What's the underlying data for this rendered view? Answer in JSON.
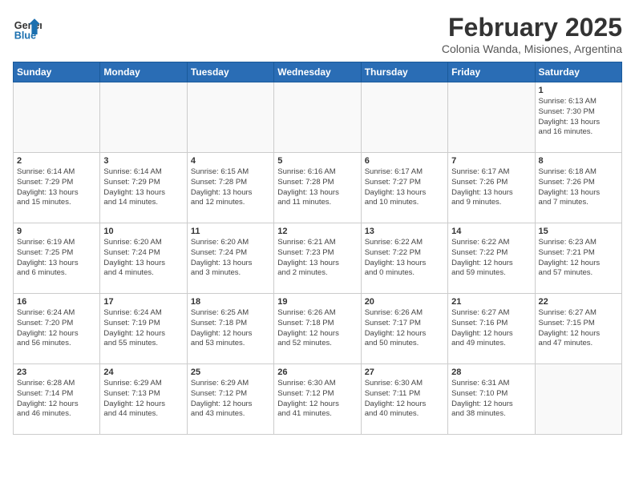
{
  "header": {
    "logo_line1": "General",
    "logo_line2": "Blue",
    "month": "February 2025",
    "location": "Colonia Wanda, Misiones, Argentina"
  },
  "weekdays": [
    "Sunday",
    "Monday",
    "Tuesday",
    "Wednesday",
    "Thursday",
    "Friday",
    "Saturday"
  ],
  "weeks": [
    [
      {
        "day": "",
        "info": ""
      },
      {
        "day": "",
        "info": ""
      },
      {
        "day": "",
        "info": ""
      },
      {
        "day": "",
        "info": ""
      },
      {
        "day": "",
        "info": ""
      },
      {
        "day": "",
        "info": ""
      },
      {
        "day": "1",
        "info": "Sunrise: 6:13 AM\nSunset: 7:30 PM\nDaylight: 13 hours\nand 16 minutes."
      }
    ],
    [
      {
        "day": "2",
        "info": "Sunrise: 6:14 AM\nSunset: 7:29 PM\nDaylight: 13 hours\nand 15 minutes."
      },
      {
        "day": "3",
        "info": "Sunrise: 6:14 AM\nSunset: 7:29 PM\nDaylight: 13 hours\nand 14 minutes."
      },
      {
        "day": "4",
        "info": "Sunrise: 6:15 AM\nSunset: 7:28 PM\nDaylight: 13 hours\nand 12 minutes."
      },
      {
        "day": "5",
        "info": "Sunrise: 6:16 AM\nSunset: 7:28 PM\nDaylight: 13 hours\nand 11 minutes."
      },
      {
        "day": "6",
        "info": "Sunrise: 6:17 AM\nSunset: 7:27 PM\nDaylight: 13 hours\nand 10 minutes."
      },
      {
        "day": "7",
        "info": "Sunrise: 6:17 AM\nSunset: 7:26 PM\nDaylight: 13 hours\nand 9 minutes."
      },
      {
        "day": "8",
        "info": "Sunrise: 6:18 AM\nSunset: 7:26 PM\nDaylight: 13 hours\nand 7 minutes."
      }
    ],
    [
      {
        "day": "9",
        "info": "Sunrise: 6:19 AM\nSunset: 7:25 PM\nDaylight: 13 hours\nand 6 minutes."
      },
      {
        "day": "10",
        "info": "Sunrise: 6:20 AM\nSunset: 7:24 PM\nDaylight: 13 hours\nand 4 minutes."
      },
      {
        "day": "11",
        "info": "Sunrise: 6:20 AM\nSunset: 7:24 PM\nDaylight: 13 hours\nand 3 minutes."
      },
      {
        "day": "12",
        "info": "Sunrise: 6:21 AM\nSunset: 7:23 PM\nDaylight: 13 hours\nand 2 minutes."
      },
      {
        "day": "13",
        "info": "Sunrise: 6:22 AM\nSunset: 7:22 PM\nDaylight: 13 hours\nand 0 minutes."
      },
      {
        "day": "14",
        "info": "Sunrise: 6:22 AM\nSunset: 7:22 PM\nDaylight: 12 hours\nand 59 minutes."
      },
      {
        "day": "15",
        "info": "Sunrise: 6:23 AM\nSunset: 7:21 PM\nDaylight: 12 hours\nand 57 minutes."
      }
    ],
    [
      {
        "day": "16",
        "info": "Sunrise: 6:24 AM\nSunset: 7:20 PM\nDaylight: 12 hours\nand 56 minutes."
      },
      {
        "day": "17",
        "info": "Sunrise: 6:24 AM\nSunset: 7:19 PM\nDaylight: 12 hours\nand 55 minutes."
      },
      {
        "day": "18",
        "info": "Sunrise: 6:25 AM\nSunset: 7:18 PM\nDaylight: 12 hours\nand 53 minutes."
      },
      {
        "day": "19",
        "info": "Sunrise: 6:26 AM\nSunset: 7:18 PM\nDaylight: 12 hours\nand 52 minutes."
      },
      {
        "day": "20",
        "info": "Sunrise: 6:26 AM\nSunset: 7:17 PM\nDaylight: 12 hours\nand 50 minutes."
      },
      {
        "day": "21",
        "info": "Sunrise: 6:27 AM\nSunset: 7:16 PM\nDaylight: 12 hours\nand 49 minutes."
      },
      {
        "day": "22",
        "info": "Sunrise: 6:27 AM\nSunset: 7:15 PM\nDaylight: 12 hours\nand 47 minutes."
      }
    ],
    [
      {
        "day": "23",
        "info": "Sunrise: 6:28 AM\nSunset: 7:14 PM\nDaylight: 12 hours\nand 46 minutes."
      },
      {
        "day": "24",
        "info": "Sunrise: 6:29 AM\nSunset: 7:13 PM\nDaylight: 12 hours\nand 44 minutes."
      },
      {
        "day": "25",
        "info": "Sunrise: 6:29 AM\nSunset: 7:12 PM\nDaylight: 12 hours\nand 43 minutes."
      },
      {
        "day": "26",
        "info": "Sunrise: 6:30 AM\nSunset: 7:12 PM\nDaylight: 12 hours\nand 41 minutes."
      },
      {
        "day": "27",
        "info": "Sunrise: 6:30 AM\nSunset: 7:11 PM\nDaylight: 12 hours\nand 40 minutes."
      },
      {
        "day": "28",
        "info": "Sunrise: 6:31 AM\nSunset: 7:10 PM\nDaylight: 12 hours\nand 38 minutes."
      },
      {
        "day": "",
        "info": ""
      }
    ]
  ]
}
